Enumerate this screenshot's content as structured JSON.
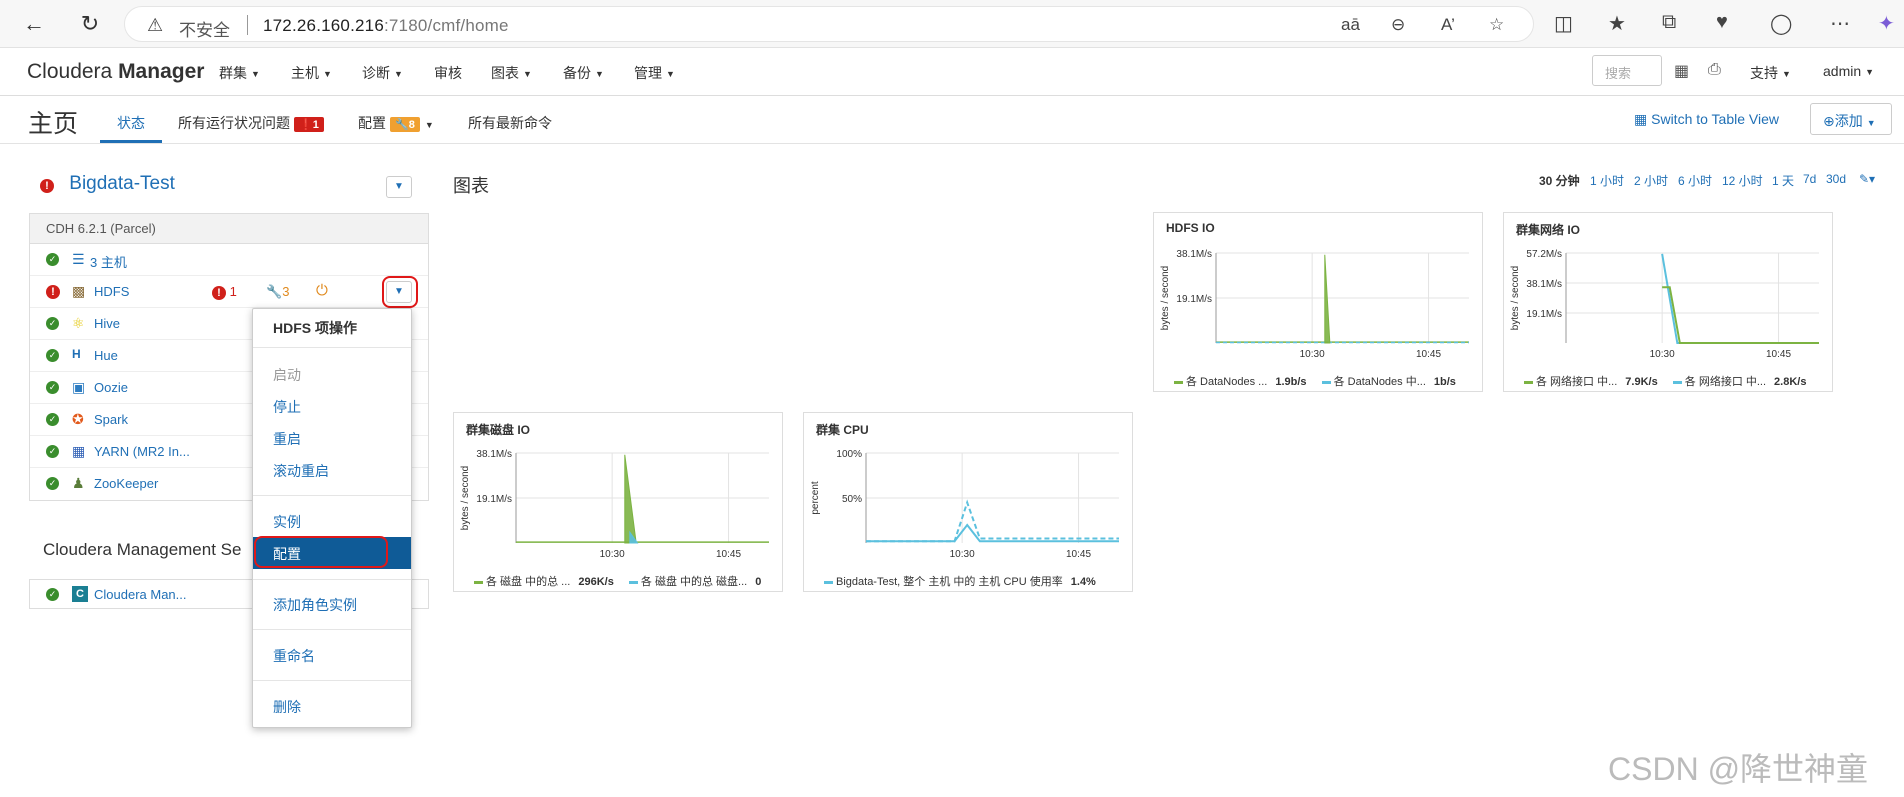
{
  "browser": {
    "insecure_label": "不安全",
    "url_host": "172.26.160.216",
    "url_rest": ":7180/cmf/home"
  },
  "nav": {
    "brand_a": "Cloudera ",
    "brand_b": "Manager",
    "menus": [
      "群集",
      "主机",
      "诊断",
      "审核",
      "图表",
      "备份",
      "管理"
    ],
    "search_placeholder": "搜索",
    "support": "支持",
    "user": "admin"
  },
  "page": {
    "title": "主页",
    "tabs": [
      "状态",
      "所有运行状况问题",
      "配置",
      "所有最新命令"
    ],
    "health_count": "1",
    "config_count": "8",
    "switch_view": "Switch to Table View",
    "add": "添加"
  },
  "cluster": {
    "name": "Bigdata-Test",
    "parcel": "CDH 6.2.1 (Parcel)",
    "services": [
      {
        "name": "3 主机",
        "icon": "hosts-icon",
        "status": "ok"
      },
      {
        "name": "HDFS",
        "icon": "hdfs-icon",
        "status": "error",
        "alerts": "1",
        "config": "3"
      },
      {
        "name": "Hive",
        "icon": "hive-icon",
        "status": "ok"
      },
      {
        "name": "Hue",
        "icon": "hue-icon",
        "status": "ok"
      },
      {
        "name": "Oozie",
        "icon": "oozie-icon",
        "status": "ok"
      },
      {
        "name": "Spark",
        "icon": "spark-icon",
        "status": "ok"
      },
      {
        "name": "YARN (MR2 In...",
        "icon": "yarn-icon",
        "status": "ok"
      },
      {
        "name": "ZooKeeper",
        "icon": "zookeeper-icon",
        "status": "ok"
      }
    ]
  },
  "mgmt": {
    "title": "Cloudera Management Se",
    "service": "Cloudera Man..."
  },
  "menu": {
    "title": "HDFS 项操作",
    "items": [
      "启动",
      "停止",
      "重启",
      "滚动重启",
      "实例",
      "配置",
      "添加角色实例",
      "重命名",
      "删除"
    ]
  },
  "charts_section": {
    "title": "图表",
    "ranges": [
      "30 分钟",
      "1 小时",
      "2 小时",
      "6 小时",
      "12 小时",
      "1 天",
      "7d",
      "30d"
    ]
  },
  "chart_data": [
    {
      "type": "area",
      "title": "HDFS IO",
      "ylabel": "bytes / second",
      "yticks": [
        "38.1M/s",
        "19.1M/s"
      ],
      "xticks": [
        "10:30",
        "10:45"
      ],
      "ylim": [
        0,
        50000000
      ],
      "series": [
        {
          "name": "各 DataNodes ...",
          "value": "1.9b/s",
          "color": "#7cb342"
        },
        {
          "name": "各 DataNodes 中...",
          "value": "1b/s",
          "color": "#5bc0de"
        }
      ]
    },
    {
      "type": "line",
      "title": "群集网络 IO",
      "ylabel": "bytes / second",
      "yticks": [
        "57.2M/s",
        "38.1M/s",
        "19.1M/s"
      ],
      "xticks": [
        "10:30",
        "10:45"
      ],
      "ylim": [
        0,
        57200000
      ],
      "series": [
        {
          "name": "各 网络接口 中...",
          "value": "7.9K/s",
          "color": "#7cb342"
        },
        {
          "name": "各 网络接口 中...",
          "value": "2.8K/s",
          "color": "#5bc0de"
        }
      ]
    },
    {
      "type": "area",
      "title": "群集磁盘 IO",
      "ylabel": "bytes / second",
      "yticks": [
        "38.1M/s",
        "19.1M/s"
      ],
      "xticks": [
        "10:30",
        "10:45"
      ],
      "ylim": [
        0,
        40000000
      ],
      "series": [
        {
          "name": "各 磁盘 中的总 ...",
          "value": "296K/s",
          "color": "#7cb342"
        },
        {
          "name": "各 磁盘 中的总 磁盘...",
          "value": "0",
          "color": "#5bc0de"
        }
      ]
    },
    {
      "type": "line",
      "title": "群集 CPU",
      "ylabel": "percent",
      "yticks": [
        "100%",
        "50%"
      ],
      "xticks": [
        "10:30",
        "10:45"
      ],
      "ylim": [
        0,
        100
      ],
      "series": [
        {
          "name": "Bigdata-Test, 整个 主机 中的 主机 CPU 使用率",
          "value": "1.4%",
          "color": "#5bc0de"
        }
      ]
    }
  ],
  "watermark": "CSDN @降世神童"
}
